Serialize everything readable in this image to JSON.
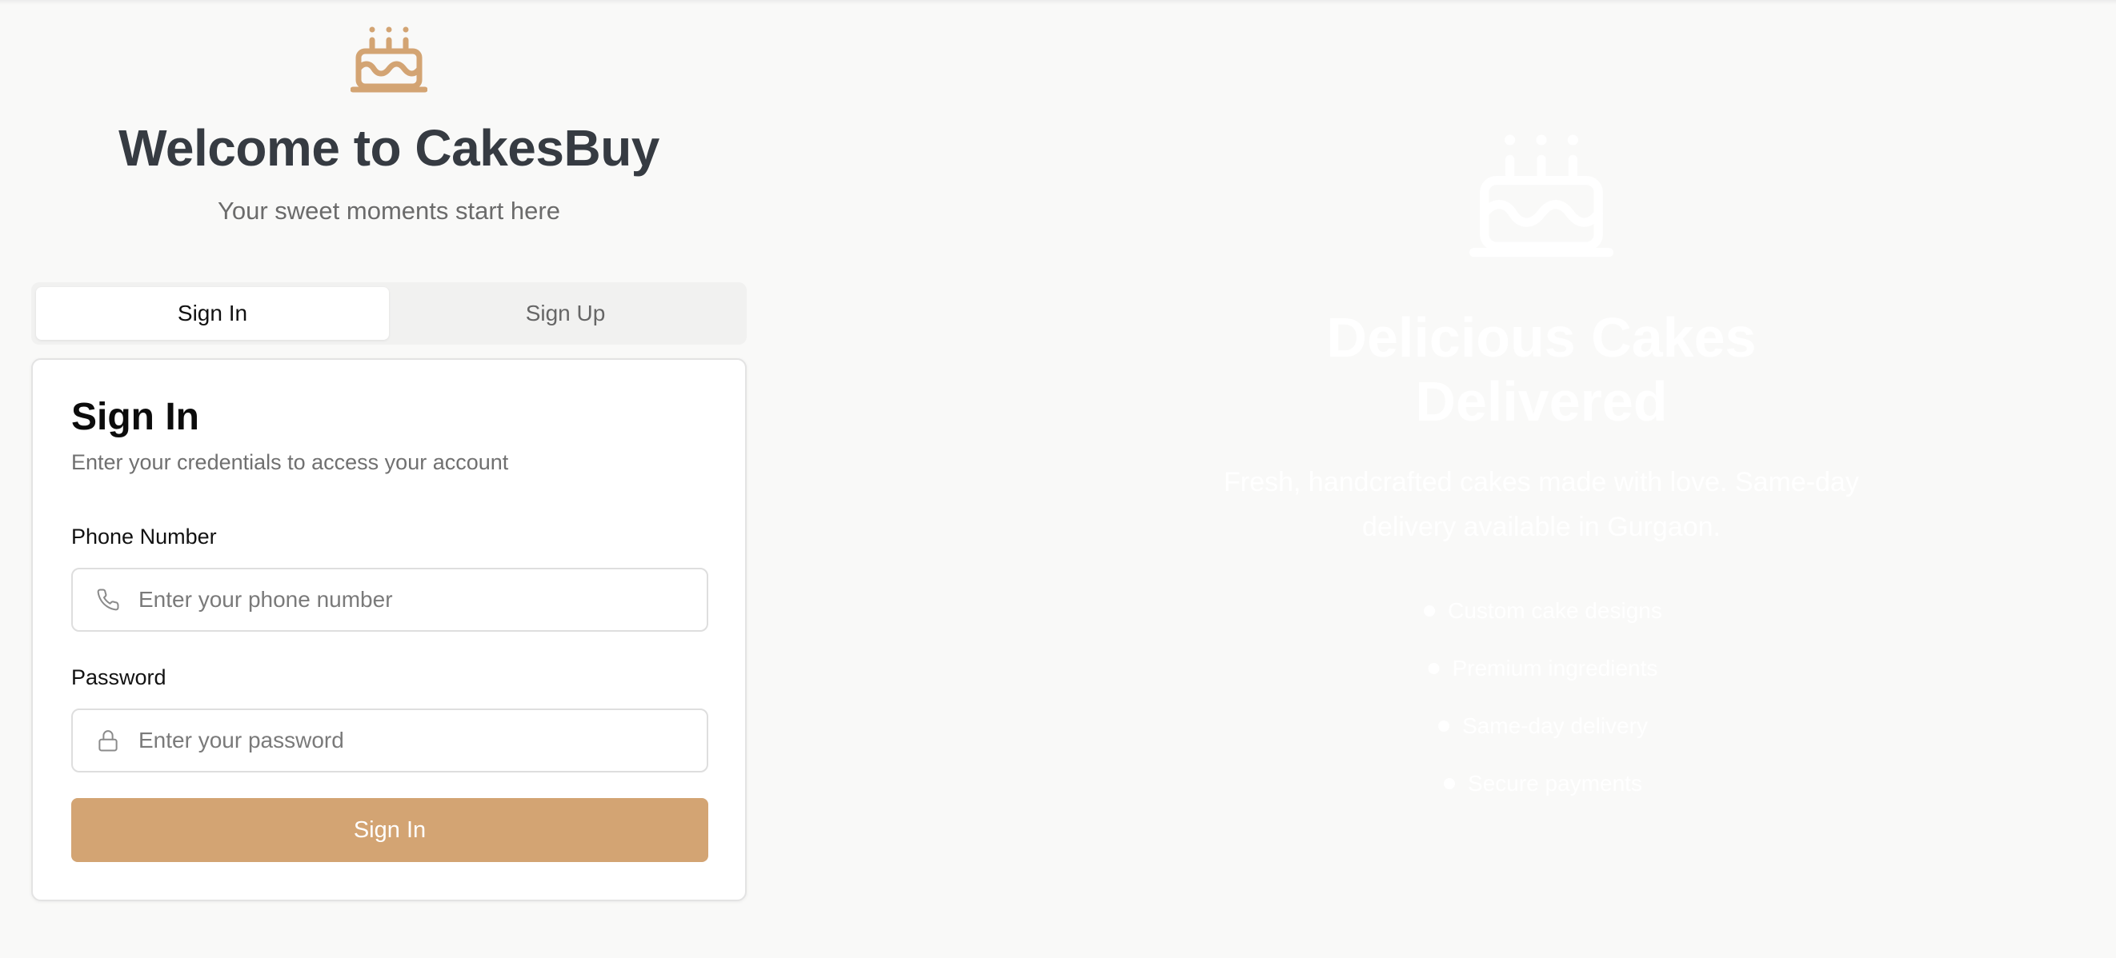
{
  "brand": {
    "logo_icon": "cake-icon",
    "accent_color": "#d3a473"
  },
  "header": {
    "title": "Welcome to CakesBuy",
    "tagline": "Your sweet moments start here"
  },
  "tabs": [
    {
      "label": "Sign In",
      "active": true
    },
    {
      "label": "Sign Up",
      "active": false
    }
  ],
  "form": {
    "title": "Sign In",
    "subtitle": "Enter your credentials to access your account",
    "phone": {
      "label": "Phone Number",
      "placeholder": "Enter your phone number",
      "value": "",
      "icon": "phone-icon"
    },
    "password": {
      "label": "Password",
      "placeholder": "Enter your password",
      "value": "",
      "icon": "lock-icon"
    },
    "submit_label": "Sign In"
  },
  "hero": {
    "icon": "cake-icon",
    "title_line1": "Delicious Cakes",
    "title_line2": "Delivered",
    "subtitle_line1": "Fresh, handcrafted cakes made with love. Same-day",
    "subtitle_line2": "delivery available in Gurgaon.",
    "features": [
      "Custom cake designs",
      "Premium ingredients",
      "Same-day delivery",
      "Secure payments"
    ]
  }
}
